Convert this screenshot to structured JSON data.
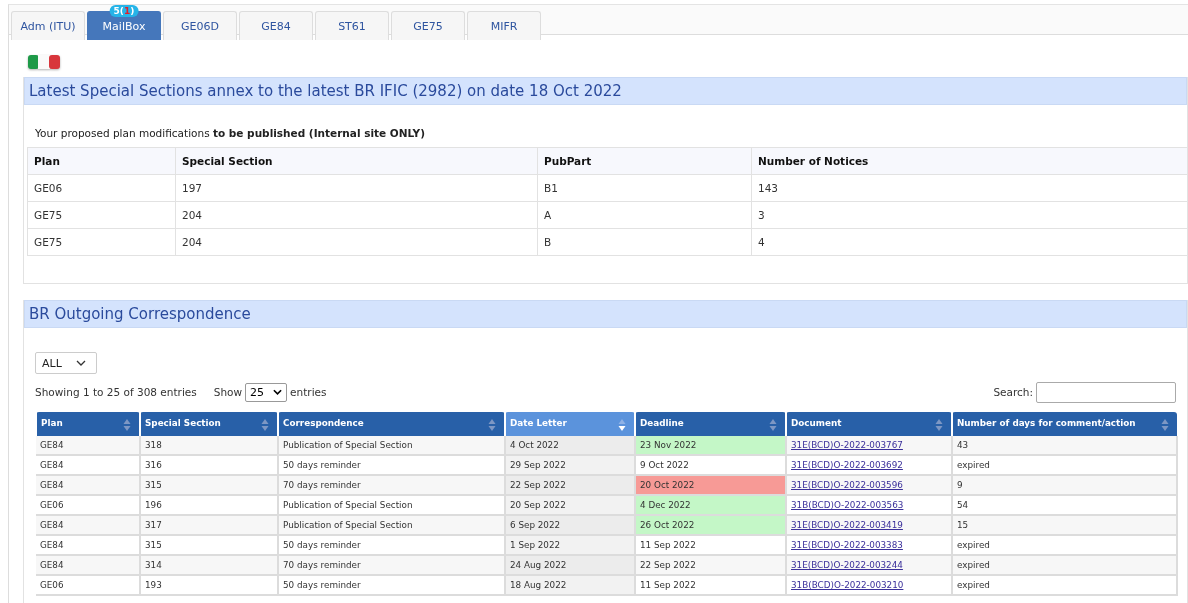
{
  "tabs": [
    {
      "label": "Adm (ITU)",
      "selected": false
    },
    {
      "label": "MailBox",
      "selected": true,
      "badge": [
        {
          "text": "5(",
          "kind": "plain"
        },
        {
          "text": "1",
          "kind": "alert"
        },
        {
          "text": ")",
          "kind": "plain"
        }
      ]
    },
    {
      "label": "GE06D",
      "selected": false
    },
    {
      "label": "GE84",
      "selected": false
    },
    {
      "label": "ST61",
      "selected": false
    },
    {
      "label": "GE75",
      "selected": false
    },
    {
      "label": "MIFR",
      "selected": false
    }
  ],
  "special_sections": {
    "title": "Latest Special Sections annex to the latest BR IFIC (2982) on date 18 Oct 2022",
    "note": "Your proposed plan modifications **to be published (Internal site ONLY)**",
    "columns": [
      "Plan",
      "Special Section",
      "PubPart",
      "Number of Notices"
    ],
    "rows": [
      [
        "GE06",
        "197",
        "B1",
        "143"
      ],
      [
        "GE75",
        "204",
        "A",
        "3"
      ],
      [
        "GE75",
        "204",
        "B",
        "4"
      ]
    ]
  },
  "correspondence": {
    "title": "BR Outgoing Correspondence",
    "filter": "ALL",
    "info": "Showing 1 to 25 of 308 entries",
    "length_label_before": "Show",
    "length_value": "25",
    "length_label_after": "entries",
    "search_label": "Search:",
    "columns": [
      {
        "label": "Plan",
        "sorted": false
      },
      {
        "label": "Special Section",
        "sorted": false
      },
      {
        "label": "Correspondence",
        "sorted": false
      },
      {
        "label": "Date Letter",
        "sorted": true
      },
      {
        "label": "Deadline",
        "sorted": false
      },
      {
        "label": "Document",
        "sorted": false
      },
      {
        "label": "Number of days for comment/action",
        "sorted": false
      }
    ],
    "rows": [
      {
        "plan": "GE84",
        "section": "318",
        "correspondence": "Publication of Special Section",
        "date": "4 Oct 2022",
        "deadline": "23 Nov 2022",
        "color": "#c4f7c7",
        "document": "31E(BCD)O-2022-003767",
        "days": "43"
      },
      {
        "plan": "GE84",
        "section": "316",
        "correspondence": "50 days reminder",
        "date": "29 Sep 2022",
        "deadline": "9 Oct 2022",
        "document": "31E(BCD)O-2022-003692",
        "days": "expired"
      },
      {
        "plan": "GE84",
        "section": "315",
        "correspondence": "70 days reminder",
        "date": "22 Sep 2022",
        "deadline": "20 Oct 2022",
        "color": "#f79a96",
        "document": "31E(BCD)O-2022-003596",
        "days": "9"
      },
      {
        "plan": "GE06",
        "section": "196",
        "correspondence": "Publication of Special Section",
        "date": "20 Sep 2022",
        "deadline": "4 Dec 2022",
        "color": "#c4f7c7",
        "document": "31B(BCD)O-2022-003563",
        "days": "54"
      },
      {
        "plan": "GE84",
        "section": "317",
        "correspondence": "Publication of Special Section",
        "date": "6 Sep 2022",
        "deadline": "26 Oct 2022",
        "color": "#c4f7c7",
        "document": "31E(BCD)O-2022-003419",
        "days": "15"
      },
      {
        "plan": "GE84",
        "section": "315",
        "correspondence": "50 days reminder",
        "date": "1 Sep 2022",
        "deadline": "11 Sep 2022",
        "document": "31E(BCD)O-2022-003383",
        "days": "expired"
      },
      {
        "plan": "GE84",
        "section": "314",
        "correspondence": "70 days reminder",
        "date": "24 Aug 2022",
        "deadline": "22 Sep 2022",
        "document": "31E(BCD)O-2022-003244",
        "days": "expired"
      },
      {
        "plan": "GE06",
        "section": "193",
        "correspondence": "50 days reminder",
        "date": "18 Aug 2022",
        "deadline": "11 Sep 2022",
        "document": "31B(BCD)O-2022-003210",
        "days": "expired"
      }
    ]
  }
}
